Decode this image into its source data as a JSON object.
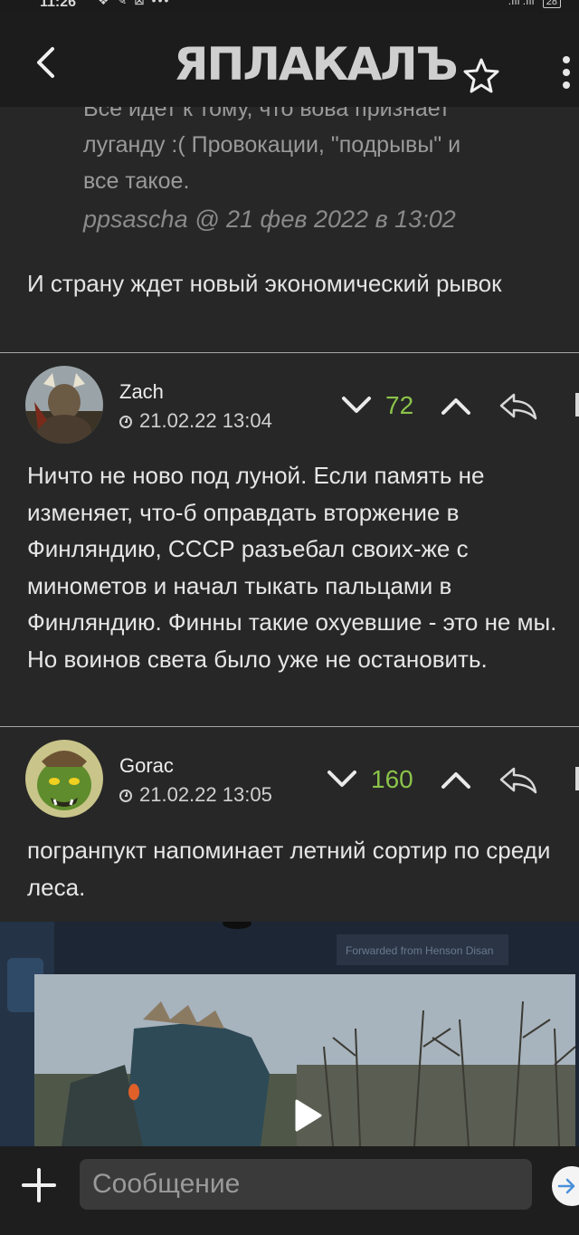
{
  "status_bar": {
    "time": "11:26",
    "icons": "❖ ✎ ⊠ •••",
    "signal": ".ııl  .ııl",
    "battery": "28"
  },
  "header": {
    "logo": "ЯПЛАКАЛЪ"
  },
  "quoted": {
    "lines": [
      "Все идет к тому, что вова признает",
      "луганду :( Провокации, \"подрывы\" и",
      "все такое."
    ],
    "author": "ppsascha @ 21 фев 2022 в 13:02"
  },
  "reply": {
    "text": "И страну ждет новый экономический рывок"
  },
  "comments": [
    {
      "username": "Zach",
      "date": "21.02.22 13:04",
      "score": "72",
      "text": "Ничто не ново под луной. Если память не изменяет, что-б оправдать вторжение в Финляндию, СССР разъебал своих-же с минометов и начал тыкать пальцами в Финляндию. Финны такие охуевшие - это не мы. Но воинов света было уже не остановить."
    },
    {
      "username": "Gorac",
      "date": "21.02.22 13:05",
      "score": "160",
      "text": "погранпукт напоминает летний сортир по среди леса."
    }
  ],
  "video": {
    "caption": "Forwarded from Henson Disan"
  },
  "composer": {
    "placeholder": "Сообщение"
  },
  "colors": {
    "background": "#272727",
    "score": "#8bc34a",
    "divider": "#a8a8a8"
  },
  "icons": [
    "back-icon",
    "star-icon",
    "menu-icon",
    "chevron-down-icon",
    "chevron-up-icon",
    "reply-icon",
    "clock-icon",
    "play-icon",
    "plus-icon",
    "send-icon"
  ]
}
